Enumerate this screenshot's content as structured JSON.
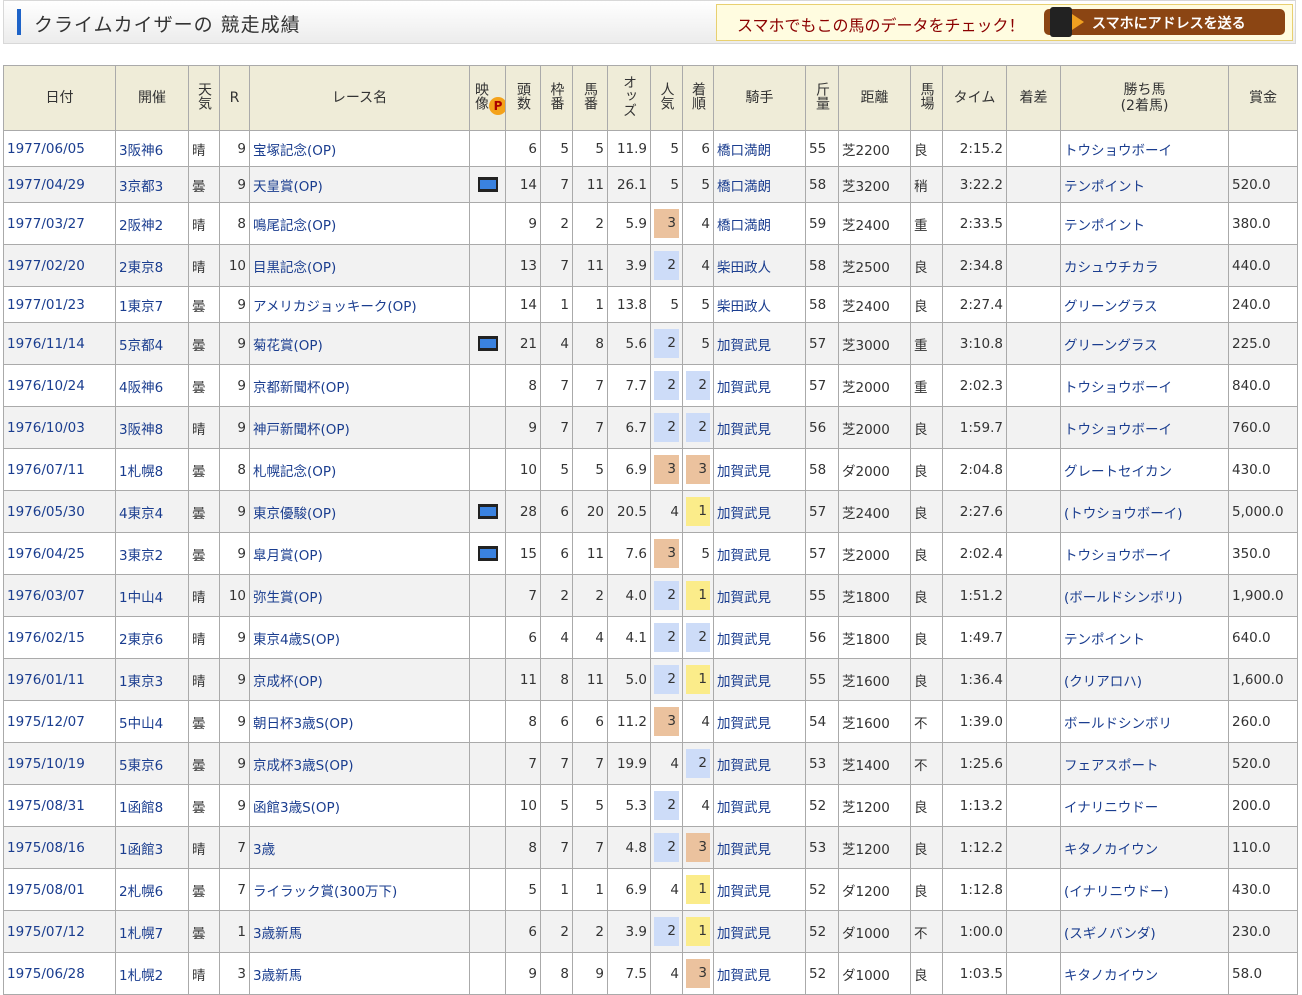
{
  "title": "クライムカイザーの 競走成績",
  "promo": {
    "text": "スマホでもこの馬のデータをチェック！",
    "button": "スマホにアドレスを送る"
  },
  "headers": [
    "日付",
    "開催",
    "天気",
    "R",
    "レース名",
    "映像",
    "頭数",
    "枠番",
    "馬番",
    "オッズ",
    "人気",
    "着順",
    "騎手",
    "斤量",
    "距離",
    "馬場",
    "タイム",
    "着差",
    "勝ち馬\n(2着馬)",
    "賞金"
  ],
  "video_badge": "P",
  "colors": {
    "first": "#fbec8a",
    "second": "#cddcf8",
    "third": "#ebc29e",
    "header_bg": "#efecd8",
    "link": "#1a3d8f"
  },
  "rows": [
    [
      "1977/06/05",
      "3阪神6",
      "晴",
      "9",
      "宝塚記念(OP)",
      "",
      "6",
      "5",
      "5",
      "11.9",
      "5",
      "6",
      "橋口満朗",
      "55",
      "芝2200",
      "良",
      "2:15.2",
      "",
      "トウショウボーイ",
      ""
    ],
    [
      "1977/04/29",
      "3京都3",
      "曇",
      "9",
      "天皇賞(OP)",
      "video",
      "14",
      "7",
      "11",
      "26.1",
      "5",
      "5",
      "橋口満朗",
      "58",
      "芝3200",
      "稍",
      "3:22.2",
      "",
      "テンポイント",
      "520.0"
    ],
    [
      "1977/03/27",
      "2阪神2",
      "晴",
      "8",
      "鳴尾記念(OP)",
      "",
      "9",
      "2",
      "2",
      "5.9",
      "3",
      "4",
      "橋口満朗",
      "59",
      "芝2400",
      "重",
      "2:33.5",
      "",
      "テンポイント",
      "380.0"
    ],
    [
      "1977/02/20",
      "2東京8",
      "晴",
      "10",
      "目黒記念(OP)",
      "",
      "13",
      "7",
      "11",
      "3.9",
      "2",
      "4",
      "柴田政人",
      "58",
      "芝2500",
      "良",
      "2:34.8",
      "",
      "カシュウチカラ",
      "440.0"
    ],
    [
      "1977/01/23",
      "1東京7",
      "曇",
      "9",
      "アメリカジョッキーク(OP)",
      "",
      "14",
      "1",
      "1",
      "13.8",
      "5",
      "5",
      "柴田政人",
      "58",
      "芝2400",
      "良",
      "2:27.4",
      "",
      "グリーングラス",
      "240.0"
    ],
    [
      "1976/11/14",
      "5京都4",
      "曇",
      "9",
      "菊花賞(OP)",
      "video",
      "21",
      "4",
      "8",
      "5.6",
      "2",
      "5",
      "加賀武見",
      "57",
      "芝3000",
      "重",
      "3:10.8",
      "",
      "グリーングラス",
      "225.0"
    ],
    [
      "1976/10/24",
      "4阪神6",
      "曇",
      "9",
      "京都新聞杯(OP)",
      "",
      "8",
      "7",
      "7",
      "7.7",
      "2",
      "2",
      "加賀武見",
      "57",
      "芝2000",
      "重",
      "2:02.3",
      "",
      "トウショウボーイ",
      "840.0"
    ],
    [
      "1976/10/03",
      "3阪神8",
      "晴",
      "9",
      "神戸新聞杯(OP)",
      "",
      "9",
      "7",
      "7",
      "6.7",
      "2",
      "2",
      "加賀武見",
      "56",
      "芝2000",
      "良",
      "1:59.7",
      "",
      "トウショウボーイ",
      "760.0"
    ],
    [
      "1976/07/11",
      "1札幌8",
      "曇",
      "8",
      "札幌記念(OP)",
      "",
      "10",
      "5",
      "5",
      "6.9",
      "3",
      "3",
      "加賀武見",
      "58",
      "ダ2000",
      "良",
      "2:04.8",
      "",
      "グレートセイカン",
      "430.0"
    ],
    [
      "1976/05/30",
      "4東京4",
      "曇",
      "9",
      "東京優駿(OP)",
      "video",
      "28",
      "6",
      "20",
      "20.5",
      "4",
      "1",
      "加賀武見",
      "57",
      "芝2400",
      "良",
      "2:27.6",
      "",
      "(トウショウボーイ)",
      "5,000.0"
    ],
    [
      "1976/04/25",
      "3東京2",
      "曇",
      "9",
      "皐月賞(OP)",
      "video",
      "15",
      "6",
      "11",
      "7.6",
      "3",
      "5",
      "加賀武見",
      "57",
      "芝2000",
      "良",
      "2:02.4",
      "",
      "トウショウボーイ",
      "350.0"
    ],
    [
      "1976/03/07",
      "1中山4",
      "晴",
      "10",
      "弥生賞(OP)",
      "",
      "7",
      "2",
      "2",
      "4.0",
      "2",
      "1",
      "加賀武見",
      "55",
      "芝1800",
      "良",
      "1:51.2",
      "",
      "(ボールドシンボリ)",
      "1,900.0"
    ],
    [
      "1976/02/15",
      "2東京6",
      "晴",
      "9",
      "東京4歳S(OP)",
      "",
      "6",
      "4",
      "4",
      "4.1",
      "2",
      "2",
      "加賀武見",
      "56",
      "芝1800",
      "良",
      "1:49.7",
      "",
      "テンポイント",
      "640.0"
    ],
    [
      "1976/01/11",
      "1東京3",
      "晴",
      "9",
      "京成杯(OP)",
      "",
      "11",
      "8",
      "11",
      "5.0",
      "2",
      "1",
      "加賀武見",
      "55",
      "芝1600",
      "良",
      "1:36.4",
      "",
      "(クリアロハ)",
      "1,600.0"
    ],
    [
      "1975/12/07",
      "5中山4",
      "曇",
      "9",
      "朝日杯3歳S(OP)",
      "",
      "8",
      "6",
      "6",
      "11.2",
      "3",
      "4",
      "加賀武見",
      "54",
      "芝1600",
      "不",
      "1:39.0",
      "",
      "ボールドシンボリ",
      "260.0"
    ],
    [
      "1975/10/19",
      "5東京6",
      "曇",
      "9",
      "京成杯3歳S(OP)",
      "",
      "7",
      "7",
      "7",
      "19.9",
      "4",
      "2",
      "加賀武見",
      "53",
      "芝1400",
      "不",
      "1:25.6",
      "",
      "フェアスポート",
      "520.0"
    ],
    [
      "1975/08/31",
      "1函館8",
      "曇",
      "9",
      "函館3歳S(OP)",
      "",
      "10",
      "5",
      "5",
      "5.3",
      "2",
      "4",
      "加賀武見",
      "52",
      "芝1200",
      "良",
      "1:13.2",
      "",
      "イナリニウドー",
      "200.0"
    ],
    [
      "1975/08/16",
      "1函館3",
      "晴",
      "7",
      "3歳",
      "",
      "8",
      "7",
      "7",
      "4.8",
      "2",
      "3",
      "加賀武見",
      "53",
      "芝1200",
      "良",
      "1:12.2",
      "",
      "キタノカイウン",
      "110.0"
    ],
    [
      "1975/08/01",
      "2札幌6",
      "曇",
      "7",
      "ライラック賞(300万下)",
      "",
      "5",
      "1",
      "1",
      "6.9",
      "4",
      "1",
      "加賀武見",
      "52",
      "ダ1200",
      "良",
      "1:12.8",
      "",
      "(イナリニウドー)",
      "430.0"
    ],
    [
      "1975/07/12",
      "1札幌7",
      "曇",
      "1",
      "3歳新馬",
      "",
      "6",
      "2",
      "2",
      "3.9",
      "2",
      "1",
      "加賀武見",
      "52",
      "ダ1000",
      "不",
      "1:00.0",
      "",
      "(スギノバンダ)",
      "230.0"
    ],
    [
      "1975/06/28",
      "1札幌2",
      "晴",
      "3",
      "3歳新馬",
      "",
      "9",
      "8",
      "9",
      "7.5",
      "4",
      "3",
      "加賀武見",
      "52",
      "ダ1000",
      "良",
      "1:03.5",
      "",
      "キタノカイウン",
      "58.0"
    ]
  ]
}
